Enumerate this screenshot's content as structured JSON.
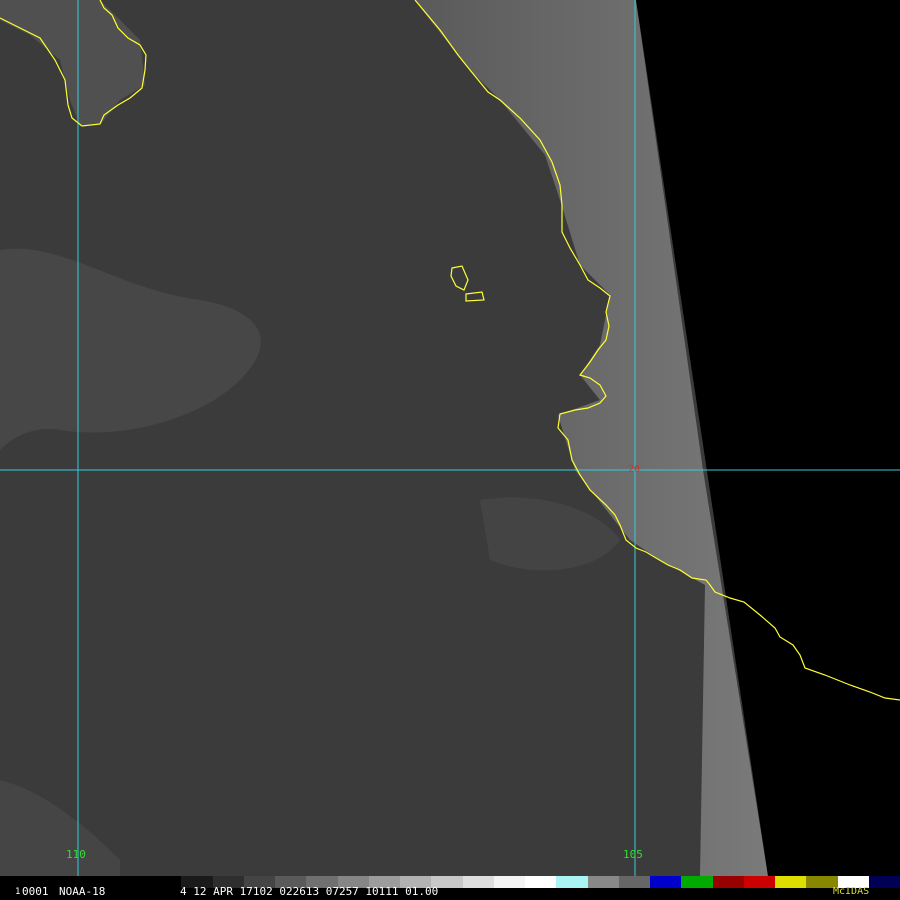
{
  "image": {
    "sensor_label": "NOAA-18",
    "frame_label": "0001",
    "frame_prefix": "1",
    "datetime_label": "4 12 APR 17102 022613 07257 10111 01.00",
    "brand": "McIDAS"
  },
  "graticule": {
    "lon_labels": [
      "110",
      "105"
    ],
    "lat_label": "20"
  },
  "colors": {
    "coastline": "#ffff33",
    "grid": "#33ccdd",
    "lon_label": "#33dd33",
    "lat_label": "#cc3333",
    "brand": "#dddd33",
    "ocean": "#3a3a3a",
    "swath_edge": "#000000"
  },
  "colorbar": {
    "segments": [
      "#000000",
      "#1a1a1a",
      "#2e2e2e",
      "#444444",
      "#5a5a5a",
      "#707070",
      "#868686",
      "#9c9c9c",
      "#b2b2b2",
      "#c8c8c8",
      "#dedede",
      "#f4f4f4",
      "#ffffff",
      "#aaf4f4",
      "#888888",
      "#666666",
      "#0000cc",
      "#00aa00",
      "#990000",
      "#cc0000",
      "#dddd00",
      "#888800",
      "#ffffff",
      "#000055"
    ]
  }
}
